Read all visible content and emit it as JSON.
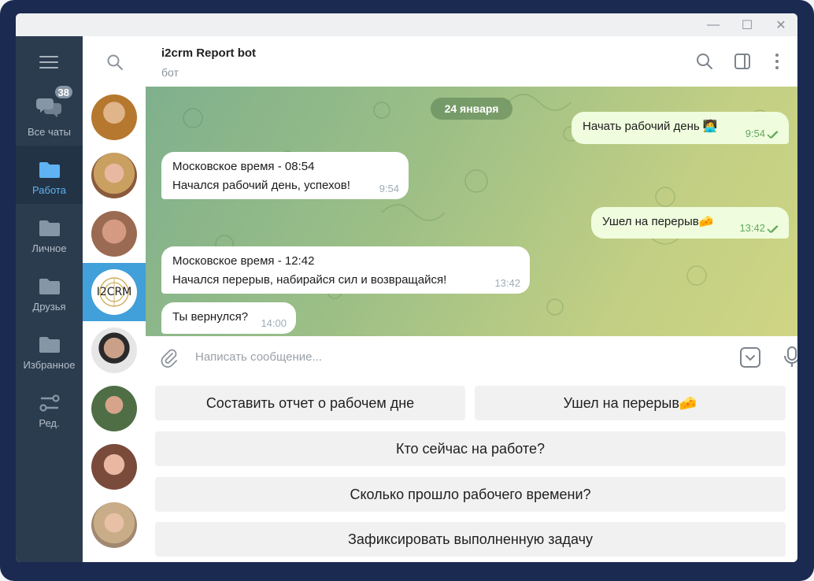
{
  "window": {
    "controls": [
      "—",
      "☐",
      "✕"
    ]
  },
  "folders": {
    "unread_badge": "38",
    "items": [
      {
        "label": "Все чаты",
        "icon": "chats-icon",
        "active": false
      },
      {
        "label": "Работа",
        "icon": "folder-icon",
        "active": true
      },
      {
        "label": "Личное",
        "icon": "folder-icon",
        "active": false
      },
      {
        "label": "Друзья",
        "icon": "folder-icon",
        "active": false
      },
      {
        "label": "Избранное",
        "icon": "folder-icon",
        "active": false
      },
      {
        "label": "Ред.",
        "icon": "edit-folders-icon",
        "active": false
      }
    ]
  },
  "chatlist": {
    "avatars": [
      {
        "name": "avatar-1",
        "color": "#b5782e"
      },
      {
        "name": "avatar-2",
        "color": "#8a5a3c"
      },
      {
        "name": "avatar-3",
        "color": "#9a6a52"
      },
      {
        "name": "avatar-i2crm",
        "text": "I2CRM",
        "active": true
      },
      {
        "name": "avatar-5",
        "color": "#55504a"
      },
      {
        "name": "avatar-6",
        "color": "#4f6e45"
      },
      {
        "name": "avatar-7",
        "color": "#7a4a3a"
      },
      {
        "name": "avatar-8",
        "color": "#a18870"
      }
    ]
  },
  "header": {
    "title": "i2crm Report bot",
    "subtitle": "бот"
  },
  "messages": {
    "date": "24 января",
    "list": [
      {
        "dir": "out",
        "text": "Начать рабочий день 🧑‍💻",
        "time": "9:54"
      },
      {
        "dir": "in",
        "lines": [
          "Московское время - 08:54",
          "Начался рабочий день, успехов!"
        ],
        "time": "9:54"
      },
      {
        "dir": "out",
        "text": "Ушел на перерыв🧀",
        "time": "13:42"
      },
      {
        "dir": "in",
        "lines": [
          "Московское время - 12:42",
          "Начался перерыв, набирайся сил и возвращайся!"
        ],
        "time": "13:42"
      },
      {
        "dir": "in",
        "text": "Ты вернулся?",
        "time": "14:00"
      }
    ]
  },
  "composer": {
    "placeholder": "Написать сообщение..."
  },
  "keyboard": {
    "buttons": [
      "Составить отчет о рабочем дне",
      "Ушел на перерыв🧀",
      "Кто сейчас на работе?",
      "Сколько прошло рабочего времени?",
      "Зафиксировать выполненную задачу"
    ]
  },
  "colors": {
    "folders_bg": "#2c3c4f",
    "accent": "#419fd9",
    "out_bubble": "#effdde",
    "check": "#62a85b"
  }
}
